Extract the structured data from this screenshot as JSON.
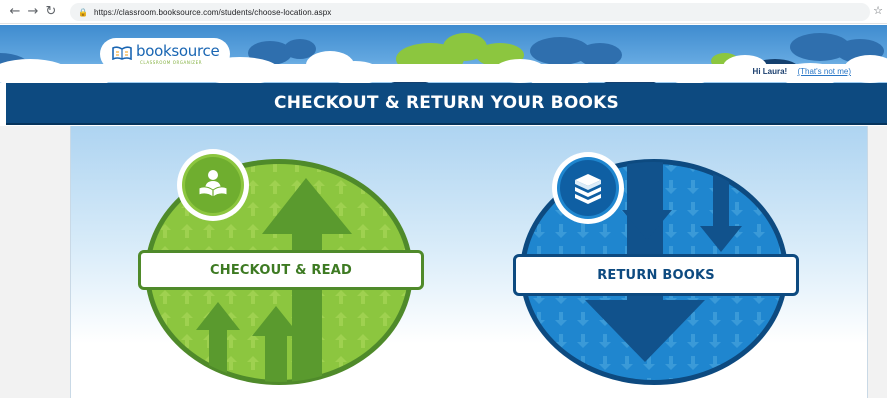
{
  "browser": {
    "url": "https://classroom.booksource.com/students/choose-location.aspx"
  },
  "header": {
    "logo_text": "booksource",
    "logo_subtitle": "CLASSROOM ORGANIZER",
    "greeting": "Hi Laura!",
    "not_me_link": "(That's not me)"
  },
  "banner": {
    "title": "CHECKOUT & RETURN YOUR BOOKS"
  },
  "options": {
    "checkout": {
      "label": "CHECKOUT & READ",
      "icon": "reader-icon",
      "color": "#8cc63f"
    },
    "return": {
      "label": "RETURN BOOKS",
      "icon": "book-stack-icon",
      "color": "#1f86cf"
    }
  },
  "colors": {
    "banner": "#0d4a80",
    "checkout_green": "#8cc63f",
    "checkout_dark_green": "#4f8a2a",
    "return_blue": "#1f86cf",
    "return_dark_blue": "#0d4a80"
  }
}
